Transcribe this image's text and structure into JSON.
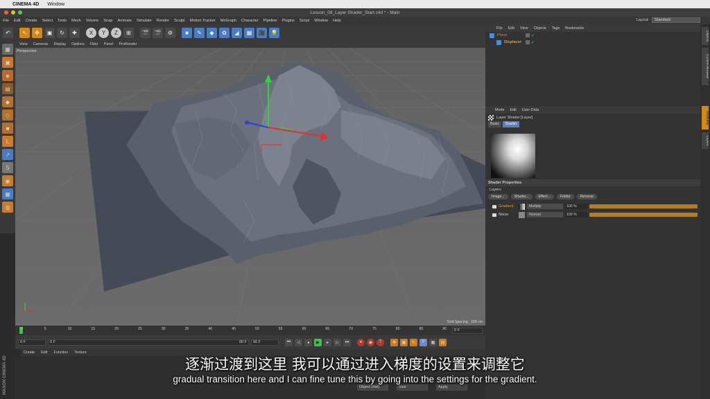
{
  "mac_menu": {
    "app": "CINEMA 4D",
    "items": [
      "Window"
    ]
  },
  "window": {
    "title": "Lesson_08_Layer-Shader_Start.c4d * - Main"
  },
  "main_menu": [
    "File",
    "Edit",
    "Create",
    "Select",
    "Tools",
    "Mesh",
    "Volume",
    "Snap",
    "Animate",
    "Simulate",
    "Render",
    "Sculpt",
    "Motion Tracker",
    "MoGraph",
    "Character",
    "Pipeline",
    "Plugins",
    "Script",
    "Window",
    "Help"
  ],
  "layout": {
    "label": "Layout:",
    "value": "Standard"
  },
  "toolbar_icons": [
    "undo-icon",
    "select-icon",
    "move-icon",
    "scale-icon",
    "rotate-icon",
    "add-icon",
    "x-axis-icon",
    "y-axis-icon",
    "z-axis-icon",
    "coord-icon",
    "render-view-icon",
    "render-pv-icon",
    "render-settings-icon",
    "cube-icon",
    "pen-icon",
    "subdiv-icon",
    "array-icon",
    "deformer-icon",
    "floor-icon",
    "camera-icon",
    "light-icon"
  ],
  "toolbar_glyphs": [
    "↶",
    "↖",
    "✥",
    "▣",
    "↻",
    "✚",
    "X",
    "Y",
    "Z",
    "⊞",
    "🎬",
    "🎬",
    "⚙",
    "■",
    "✎",
    "◆",
    "✿",
    "◢",
    "▦",
    "🎥",
    "💡"
  ],
  "viewport": {
    "menu": [
      "View",
      "Cameras",
      "Display",
      "Options",
      "Filter",
      "Panel",
      "ProRender"
    ],
    "label": "Perspective",
    "grid_spacing": "Grid Spacing : 100 cm"
  },
  "timeline": {
    "ticks": [
      "0",
      "5",
      "10",
      "15",
      "20",
      "25",
      "30",
      "35",
      "40",
      "45",
      "50",
      "55",
      "60",
      "65",
      "70",
      "75",
      "80",
      "85",
      "90"
    ],
    "end_frame": "0 F"
  },
  "transport": {
    "start": "0 F",
    "start2": "0 F",
    "end": "90 F",
    "end2": "90 F"
  },
  "material_menu": [
    "Create",
    "Edit",
    "Function",
    "Texture"
  ],
  "material_buttons": [
    "Object (Rel)",
    "Size",
    "Apply"
  ],
  "maxon": "MAXON CINEMA 4D",
  "objects": {
    "menu": [
      "File",
      "Edit",
      "View",
      "Objects",
      "Tags",
      "Bookmarks"
    ],
    "items": [
      {
        "name": "Plane",
        "color": "#d18a2a"
      },
      {
        "name": "Displacer",
        "color": "#e0a030"
      }
    ]
  },
  "attributes": {
    "menu": [
      "Mode",
      "Edit",
      "User Data"
    ],
    "shader_title": "Layer Shader [Layer]",
    "tabs": [
      "Basic",
      "Shader"
    ],
    "section": "Shader Properties",
    "layers_label": "Layers",
    "layer_buttons": [
      "Image...",
      "Shader...",
      "Effect...",
      "Folder",
      "Remove"
    ],
    "layers": [
      {
        "name": "Gradient",
        "mode": "Multiply",
        "percent": "100 %",
        "color": "#e0a030"
      },
      {
        "name": "Noise",
        "mode": "Normal",
        "percent": "100 %",
        "color": "#cfcfcf"
      }
    ]
  },
  "right_tabs": [
    "Objects",
    "Content Browser",
    "Attributes",
    "Layers"
  ],
  "subtitles": {
    "cn": "逐渐过渡到这里 我可以通过进入梯度的设置来调整它",
    "en": "gradual transition here and I can fine tune this by going into the settings for the gradient."
  }
}
